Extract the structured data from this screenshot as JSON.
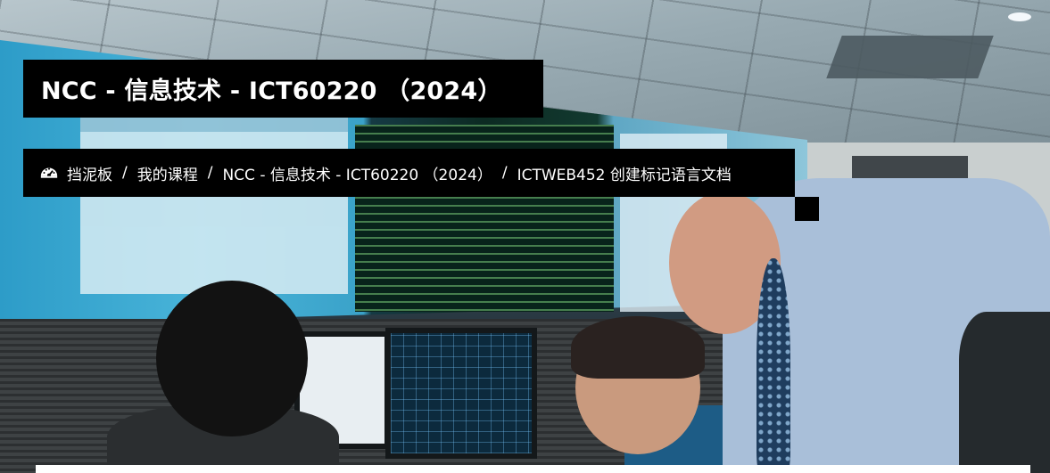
{
  "header": {
    "title": "NCC - 信息技术 - ICT60220 （2024）"
  },
  "breadcrumb": {
    "icon": "dashboard-gauge-icon",
    "separator": "/",
    "items": [
      {
        "label": "挡泥板"
      },
      {
        "label": "我的课程"
      },
      {
        "label": "NCC - 信息技术 - ICT60220 （2024）"
      },
      {
        "label": "ICTWEB452 创建标记语言文档"
      }
    ]
  },
  "colors": {
    "overlay_background": "#000000",
    "overlay_text": "#ffffff"
  }
}
